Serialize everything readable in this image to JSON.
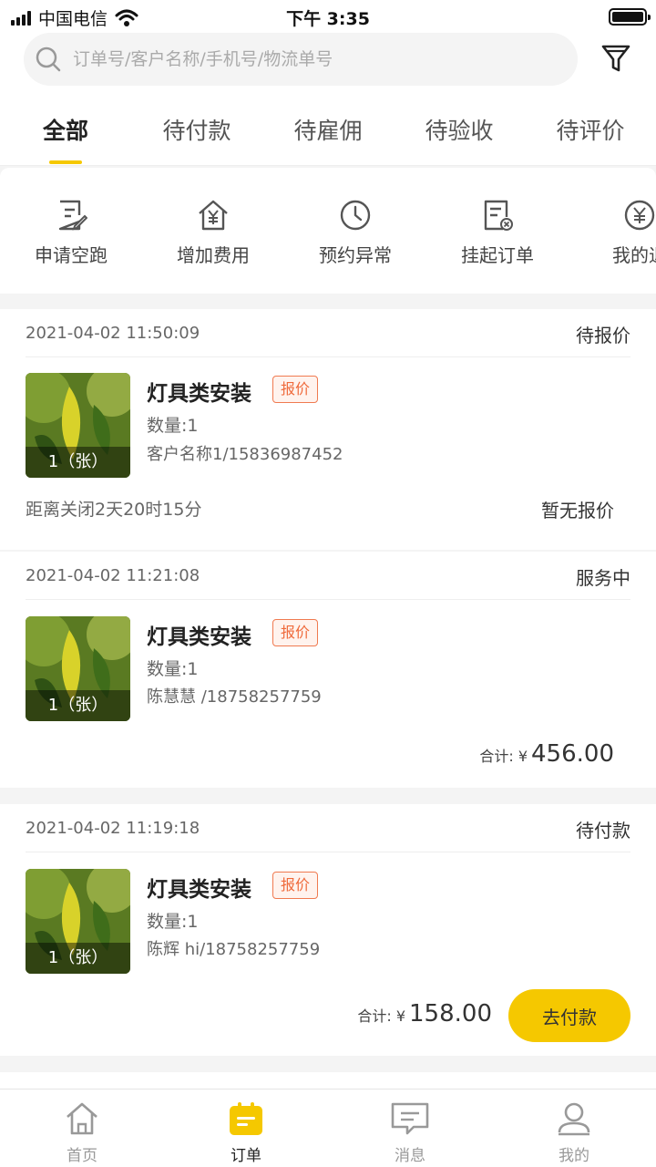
{
  "status_bar": {
    "carrier": "中国电信",
    "time": "下午 3:35"
  },
  "search": {
    "placeholder": "订单号/客户名称/手机号/物流单号"
  },
  "tabs": [
    {
      "label": "全部",
      "active": true
    },
    {
      "label": "待付款"
    },
    {
      "label": "待雇佣"
    },
    {
      "label": "待验收"
    },
    {
      "label": "待评价"
    }
  ],
  "quick_actions": [
    {
      "label": "申请空跑",
      "icon": "document-edit-icon"
    },
    {
      "label": "增加费用",
      "icon": "house-yen-icon"
    },
    {
      "label": "预约异常",
      "icon": "clock-icon"
    },
    {
      "label": "挂起订单",
      "icon": "document-cancel-icon"
    },
    {
      "label": "我的退",
      "icon": "yen-circle-icon"
    }
  ],
  "orders": [
    {
      "time": "2021-04-02 11:50:09",
      "status": "待报价",
      "title": "灯具类安装",
      "tag": "报价",
      "thumb_caption": "1（张）",
      "quantity": "数量:1",
      "customer": "客户名称1/15836987452",
      "countdown": "距离关闭2天20时15分",
      "note": "暂无报价"
    },
    {
      "time": "2021-04-02 11:21:08",
      "status": "服务中",
      "title": "灯具类安装",
      "tag": "报价",
      "thumb_caption": "1（张）",
      "quantity": "数量:1",
      "customer": "陈慧慧 /18758257759",
      "total_label": "合计: ¥",
      "total": "456.00"
    },
    {
      "time": "2021-04-02 11:19:18",
      "status": "待付款",
      "title": "灯具类安装",
      "tag": "报价",
      "thumb_caption": "1（张）",
      "quantity": "数量:1",
      "customer": "陈辉 hi/18758257759",
      "total_label": "合计: ¥",
      "total": "158.00",
      "action": "去付款"
    }
  ],
  "tab_bar": [
    {
      "label": "首页",
      "icon": "home-icon"
    },
    {
      "label": "订单",
      "icon": "order-icon",
      "active": true
    },
    {
      "label": "消息",
      "icon": "message-icon"
    },
    {
      "label": "我的",
      "icon": "profile-icon"
    }
  ],
  "colors": {
    "accent": "#f5c800",
    "tag": "#ef6a3b",
    "background": "#f4f4f4"
  }
}
